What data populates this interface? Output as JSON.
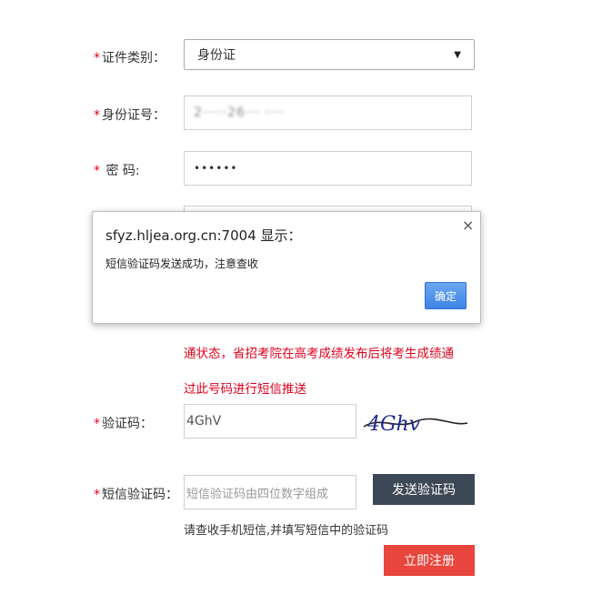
{
  "form": {
    "required_mark": "*",
    "cert_type": {
      "label": "证件类别：",
      "value": "身份证"
    },
    "id_number": {
      "label": "身份证号：",
      "value": "2·····26··· ····"
    },
    "password": {
      "label": "密 码:",
      "value": "••••••"
    },
    "notice_lines": [
      "通状态，省招考院在高考成绩发布后将考生成绩通",
      "过此号码进行短信推送"
    ],
    "captcha": {
      "label": "验证码：",
      "value": "4GhV",
      "image_text": "4Ghv"
    },
    "sms_code": {
      "label": "短信验证码：",
      "placeholder": "短信验证码由四位数字组成",
      "send_button": "发送验证码"
    },
    "sms_hint": "请查收手机短信,并填写短信中的验证码",
    "submit_button": "立即注册"
  },
  "dialog": {
    "title": "sfyz.hljea.org.cn:7004 显示：",
    "message": "短信验证码发送成功，注意查收",
    "ok_button": "确定"
  },
  "colors": {
    "required": "#e0001b",
    "send_button_bg": "#3d4856",
    "submit_button_bg": "#e8453c",
    "dialog_ok_bg": "#4a8fea"
  },
  "icons": {
    "select_arrow": "triangle-down-icon",
    "dialog_close": "close-icon"
  }
}
